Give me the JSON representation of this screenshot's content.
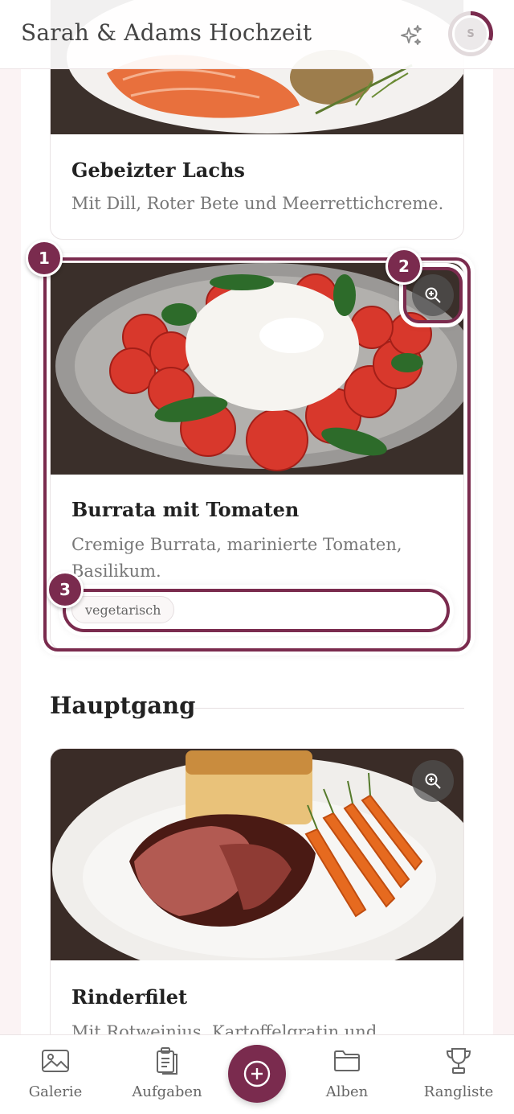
{
  "header": {
    "title": "Sarah & Adams Hochzeit",
    "sparkle_icon": "sparkles-icon",
    "avatar_initial": "S"
  },
  "dishes": [
    {
      "title": "Gebeizter Lachs",
      "description": "Mit Dill, Roter Bete und Meerrettichcreme."
    },
    {
      "title": "Burrata mit Tomaten",
      "description": "Cremige Burrata, marinierte Tomaten, Basilikum.",
      "tag": "vegetarisch"
    },
    {
      "title": "Rinderfilet",
      "description": "Mit Rotweinjus, Kartoffelgratin und"
    }
  ],
  "section": {
    "title": "Hauptgang"
  },
  "annotations": [
    "1",
    "2",
    "3"
  ],
  "nav": {
    "items": [
      {
        "label": "Galerie",
        "icon": "image-icon"
      },
      {
        "label": "Aufgaben",
        "icon": "clipboard-icon"
      },
      {
        "label": "Alben",
        "icon": "folder-icon"
      },
      {
        "label": "Rangliste",
        "icon": "trophy-icon"
      }
    ],
    "add_icon": "plus-circle-icon"
  },
  "colors": {
    "accent": "#7a2b4e",
    "background": "#fbf3f4"
  }
}
